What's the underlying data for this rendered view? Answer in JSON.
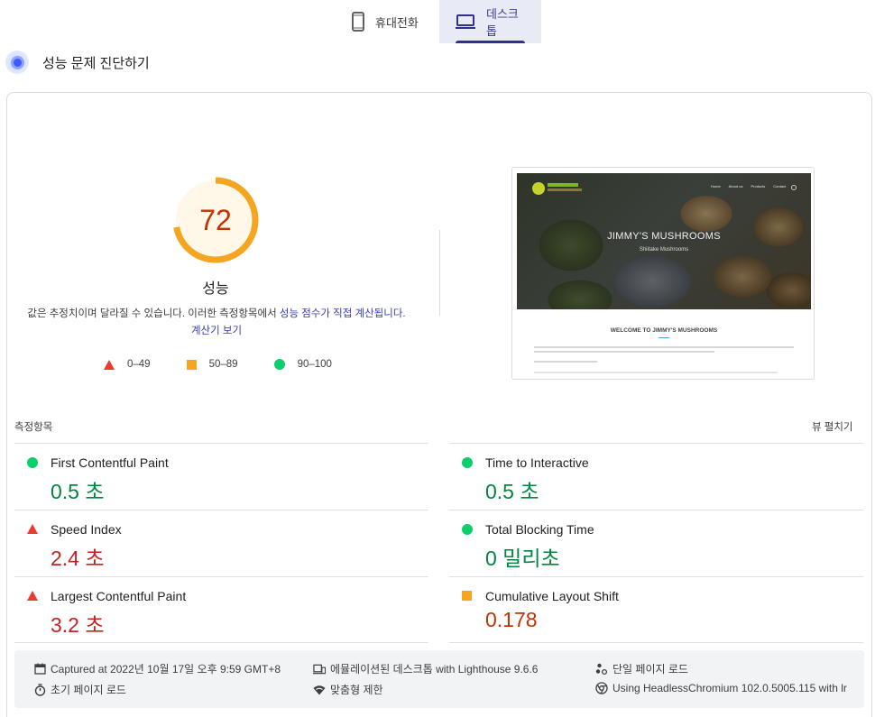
{
  "tabs": [
    {
      "label": "휴대전화",
      "icon": "smartphone-icon",
      "active": false
    },
    {
      "label": "데스크톱",
      "icon": "laptop-icon",
      "active": true
    }
  ],
  "section": {
    "title": "성능 문제 진단하기",
    "icon": "gauge-icon"
  },
  "score": {
    "value": "72",
    "fraction": 0.72,
    "label": "성능",
    "color": "#f4a620",
    "bg": "#fff7e8"
  },
  "description": {
    "text": "값은 추정치이며 달라질 수 있습니다. 이러한 측정항목에서 ",
    "link1": "성능 점수가 직접 계산됩니다",
    "sep": ". ",
    "link2": "계산기 보기"
  },
  "legend": [
    {
      "range": "0–49",
      "shape": "triangle",
      "color": "#eb3a2f"
    },
    {
      "range": "50–89",
      "shape": "square",
      "color": "#f4a620"
    },
    {
      "range": "90–100",
      "shape": "circle",
      "color": "#0cce6b"
    }
  ],
  "screenshot": {
    "site_title": "JIMMY'S MUSHROOMS",
    "site_subtitle": "Shiitake Mushrooms",
    "nav": [
      "Home",
      "About us",
      "Products",
      "Contact"
    ],
    "welcome": "WELCOME TO JIMMY'S MUSHROOMS"
  },
  "metrics": {
    "label": "측정항목",
    "expand": "뷰 펼치기",
    "left": [
      {
        "name": "First Contentful Paint",
        "value": "0.5 초",
        "rating": "good"
      },
      {
        "name": "Speed Index",
        "value": "2.4 초",
        "rating": "poor"
      },
      {
        "name": "Largest Contentful Paint",
        "value": "3.2 초",
        "rating": "poor"
      }
    ],
    "right": [
      {
        "name": "Time to Interactive",
        "value": "0.5 초",
        "rating": "good"
      },
      {
        "name": "Total Blocking Time",
        "value": "0 밀리초",
        "rating": "good"
      },
      {
        "name": "Cumulative Layout Shift",
        "value": "0.178",
        "rating": "average"
      }
    ]
  },
  "runtime": {
    "captured": "Captured at 2022년 10월 17일 오후 9:59 GMT+8",
    "load": "초기 페이지 로드",
    "device": "에뮬레이션된 데스크톱 with Lighthouse 9.6.6",
    "throttle": "맞춤형 제한",
    "session": "단일 페이지 로드",
    "browser": "Using HeadlessChromium 102.0.5005.115 with lr"
  }
}
